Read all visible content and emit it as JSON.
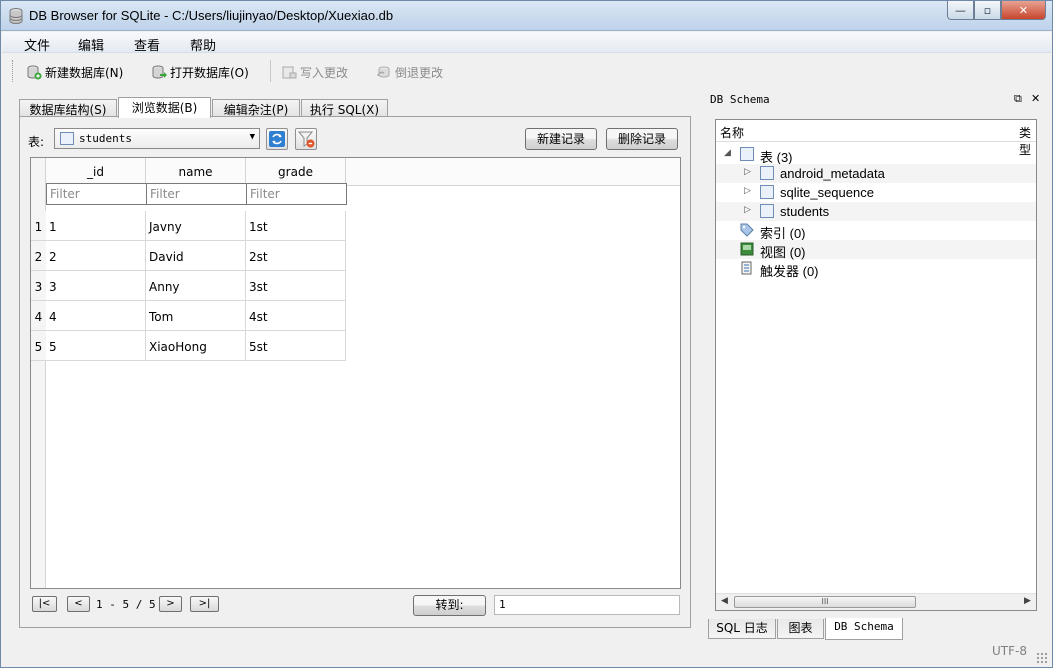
{
  "window": {
    "title": "DB Browser for SQLite - C:/Users/liujinyao/Desktop/Xuexiao.db",
    "minimize": "—",
    "maximize": "▫",
    "close": "✕"
  },
  "menu": [
    "文件",
    "编辑",
    "查看",
    "帮助"
  ],
  "toolbar": {
    "new_db": "新建数据库(N)",
    "open_db": "打开数据库(O)",
    "write_changes": "写入更改",
    "revert_changes": "倒退更改"
  },
  "tabs": [
    "数据库结构(S)",
    "浏览数据(B)",
    "编辑杂注(P)",
    "执行 SQL(X)"
  ],
  "browse": {
    "table_label": "表:",
    "selected_table": "students",
    "new_record": "新建记录",
    "delete_record": "删除记录",
    "columns": [
      "_id",
      "name",
      "grade"
    ],
    "filter_placeholder": "Filter",
    "rows": [
      {
        "num": "1",
        "cells": [
          "1",
          "Javny",
          "1st"
        ]
      },
      {
        "num": "2",
        "cells": [
          "2",
          "David",
          "2st"
        ]
      },
      {
        "num": "3",
        "cells": [
          "3",
          "Anny",
          "3st"
        ]
      },
      {
        "num": "4",
        "cells": [
          "4",
          "Tom",
          "4st"
        ]
      },
      {
        "num": "5",
        "cells": [
          "5",
          "XiaoHong",
          "5st"
        ]
      }
    ],
    "nav": {
      "first": "|<",
      "prev": "<",
      "next": ">",
      "last": ">|",
      "page_info": "1 - 5 / 5",
      "goto_label": "转到:",
      "goto_value": "1"
    }
  },
  "schema": {
    "dock_title": "DB Schema",
    "col_name": "名称",
    "col_type": "类型",
    "tables_node": "表 (3)",
    "tables": [
      "android_metadata",
      "sqlite_sequence",
      "students"
    ],
    "indexes": "索引 (0)",
    "views": "视图 (0)",
    "triggers": "触发器 (0)",
    "scroll_thumb": "III"
  },
  "dock_tabs": [
    "SQL 日志",
    "图表",
    "DB Schema"
  ],
  "status": {
    "encoding": "UTF-8"
  }
}
